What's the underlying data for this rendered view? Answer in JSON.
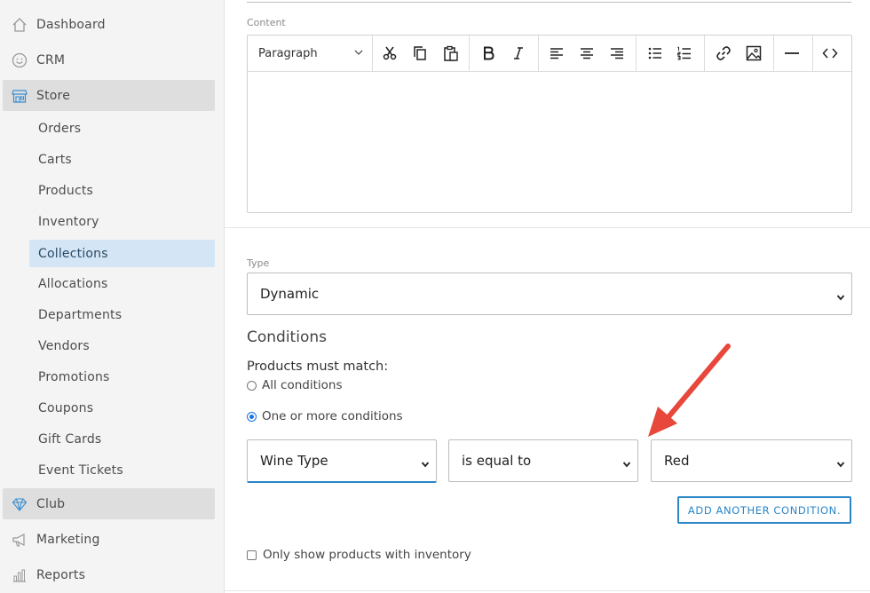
{
  "sidebar": {
    "items": [
      {
        "label": "Dashboard",
        "icon": "home-icon"
      },
      {
        "label": "CRM",
        "icon": "smiley-icon"
      },
      {
        "label": "Store",
        "icon": "storefront-icon",
        "active": true
      },
      {
        "label": "Club",
        "icon": "diamond-icon"
      },
      {
        "label": "Marketing",
        "icon": "megaphone-icon"
      },
      {
        "label": "Reports",
        "icon": "bar-chart-icon"
      }
    ],
    "store_sub": [
      "Orders",
      "Carts",
      "Products",
      "Inventory",
      "Collections",
      "Allocations",
      "Departments",
      "Vendors",
      "Promotions",
      "Coupons",
      "Gift Cards",
      "Event Tickets"
    ],
    "active_sub": "Collections"
  },
  "editor": {
    "label": "Content",
    "paragraph_select": "Paragraph",
    "toolbar_icons": [
      "cut-icon",
      "copy-icon",
      "paste-icon",
      "bold-icon",
      "italic-icon",
      "align-left-icon",
      "align-center-icon",
      "align-right-icon",
      "bullet-list-icon",
      "numbered-list-icon",
      "link-icon",
      "image-icon",
      "horizontal-rule-icon",
      "code-icon"
    ]
  },
  "type_field": {
    "label": "Type",
    "value": "Dynamic"
  },
  "conditions": {
    "heading": "Conditions",
    "match_label": "Products must match:",
    "options": [
      "All conditions",
      "One or more conditions"
    ],
    "selected_option": "One or more conditions",
    "rule": {
      "field": "Wine Type",
      "operator": "is equal to",
      "value": "Red"
    },
    "add_button": "ADD ANOTHER CONDITION.",
    "inventory_checkbox": "Only show products with inventory"
  },
  "colors": {
    "accent": "#2a86c8",
    "arrow": "#e8473b",
    "active_sub_bg": "#d4e6f5"
  }
}
